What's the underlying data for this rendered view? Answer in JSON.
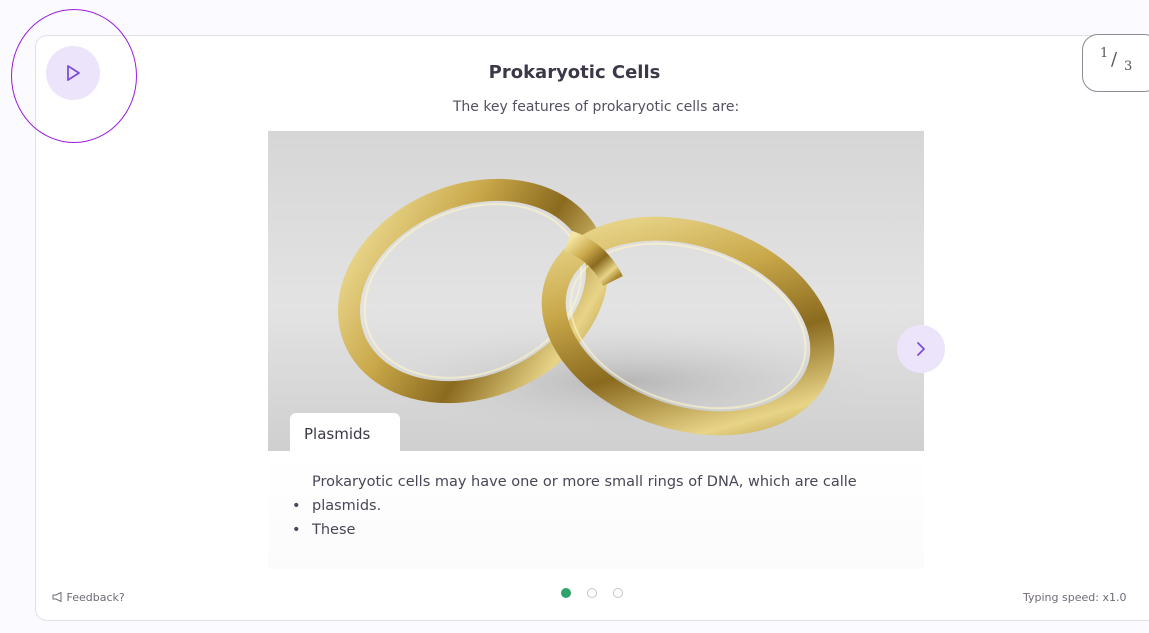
{
  "slide": {
    "title": "Prokaryotic Cells",
    "subtitle": "The key features of prokaryotic cells are:",
    "caption": "Plasmids",
    "bullets": [
      "Prokaryotic cells may have one or more small rings of DNA, which are calle",
      "plasmids.",
      "These"
    ]
  },
  "counter": {
    "current": "1",
    "slash": "/",
    "total": "3"
  },
  "footer": {
    "feedback": "Feedback?",
    "typing_speed": "Typing speed: x1.0"
  },
  "pagination": {
    "pages": 3,
    "active": 1
  },
  "icons": {
    "play": "play-icon",
    "next": "chevron-right-icon",
    "feedback": "megaphone-icon"
  },
  "colors": {
    "accent": "#ece4fb",
    "accent_stroke": "#7b4fd8",
    "highlight_ring": "#9b1ce0",
    "active_dot": "#2fa36b"
  }
}
